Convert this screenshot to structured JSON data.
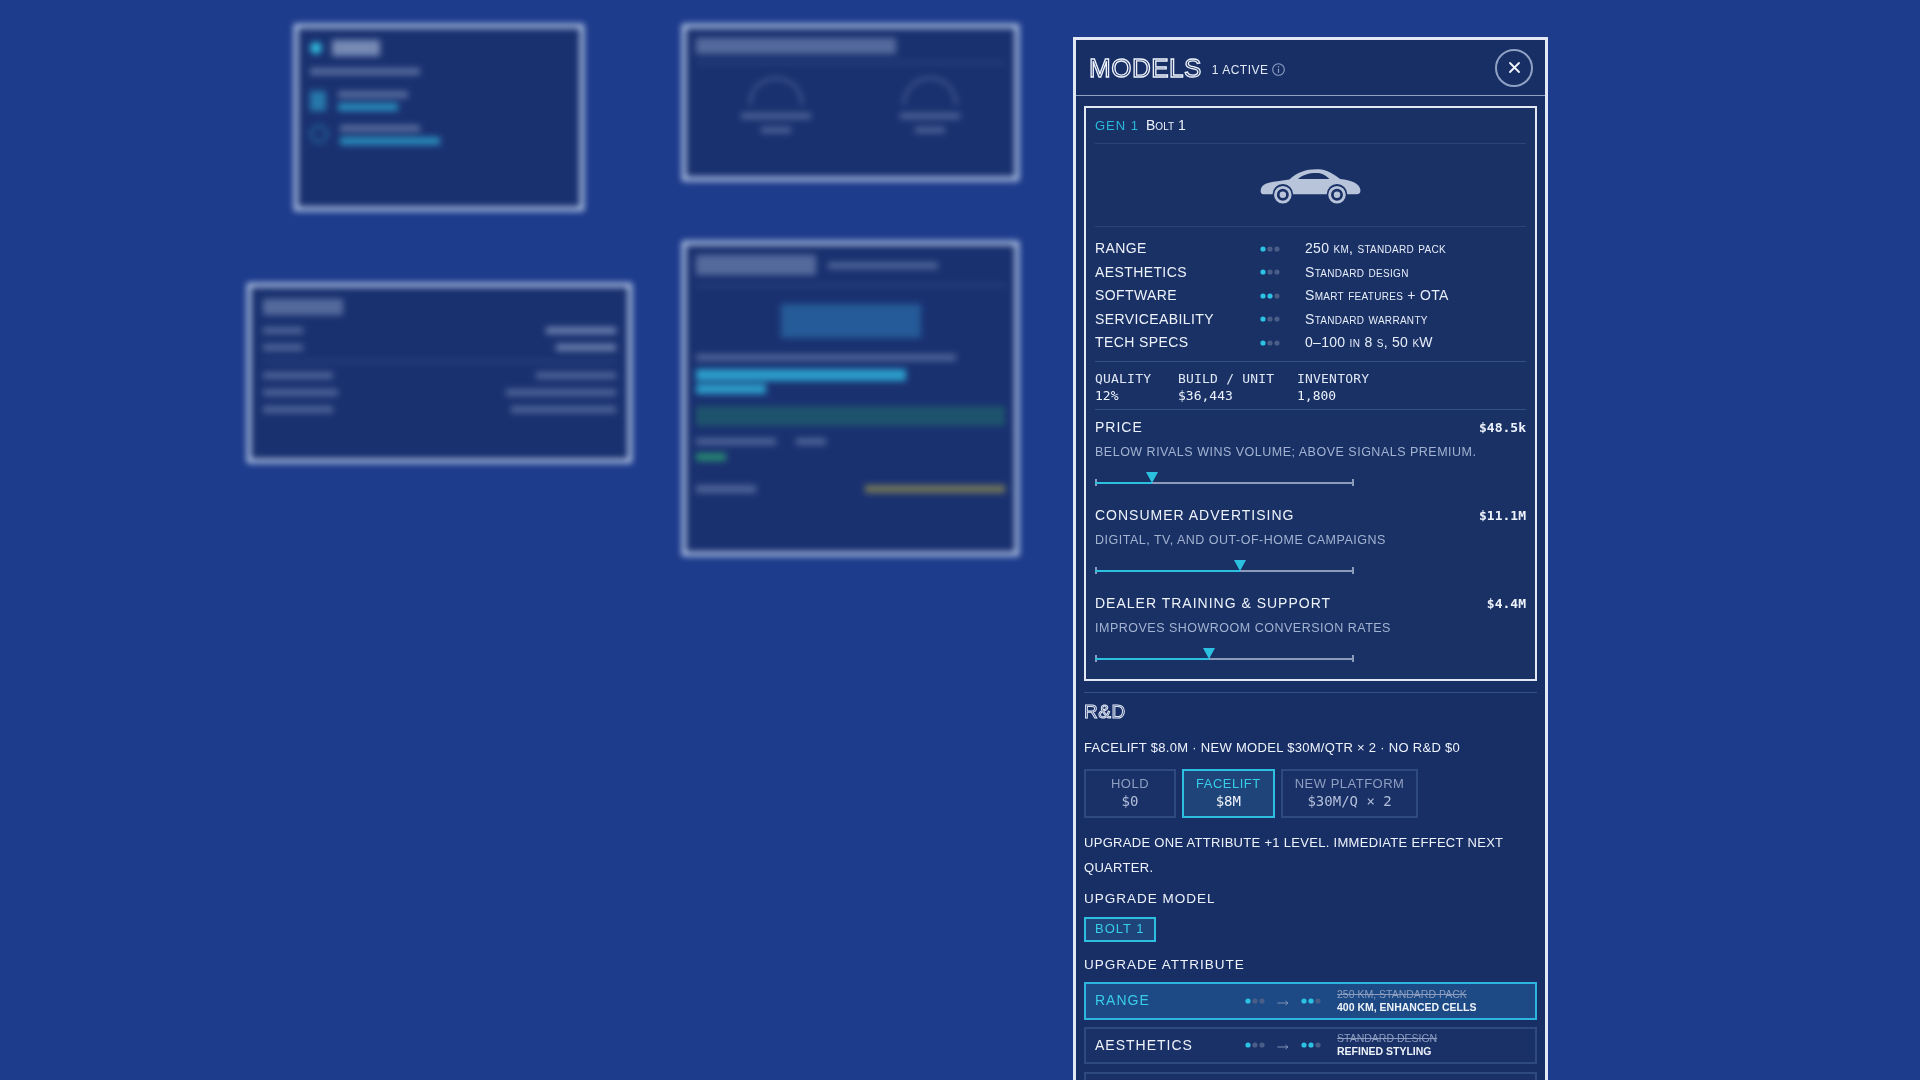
{
  "panel": {
    "title": "MODELS",
    "active_count": "1 ACTIVE"
  },
  "model": {
    "generation": "GEN 1",
    "name": "Bolt 1",
    "attributes": [
      {
        "label": "RANGE",
        "stars": 1,
        "description": "250 km, standard pack"
      },
      {
        "label": "AESTHETICS",
        "stars": 1,
        "description": "Standard design"
      },
      {
        "label": "SOFTWARE",
        "stars": 2,
        "description": "Smart features + OTA"
      },
      {
        "label": "SERVICEABILITY",
        "stars": 1,
        "description": "Standard warranty"
      },
      {
        "label": "TECH SPECS",
        "stars": 1,
        "description": "0–100 in 8 s, 50 kW"
      }
    ],
    "stats": [
      {
        "label": "QUALITY",
        "value": "12%"
      },
      {
        "label": "BUILD / UNIT",
        "value": "$36,443"
      },
      {
        "label": "INVENTORY",
        "value": "1,800"
      }
    ],
    "budgets": [
      {
        "label": "PRICE",
        "value": "$48.5k",
        "description": "BELOW RIVALS WINS VOLUME; ABOVE SIGNALS PREMIUM.",
        "level": 0.22
      },
      {
        "label": "CONSUMER ADVERTISING",
        "value": "$11.1M",
        "description": "DIGITAL, TV, AND OUT-OF-HOME CAMPAIGNS",
        "level": 0.56
      },
      {
        "label": "DEALER TRAINING & SUPPORT",
        "value": "$4.4M",
        "description": "IMPROVES SHOWROOM CONVERSION RATES",
        "level": 0.44
      }
    ]
  },
  "rnd": {
    "title": "R&D",
    "summary": "FACELIFT $8.0M · NEW MODEL $30M/QTR × 2 · NO R&D $0",
    "options": [
      {
        "label": "HOLD",
        "cost": "$0",
        "selected": false
      },
      {
        "label": "FACELIFT",
        "cost": "$8M",
        "selected": true
      },
      {
        "label": "NEW PLATFORM",
        "cost": "$30M/Q × 2",
        "selected": false
      }
    ],
    "note": "UPGRADE ONE ATTRIBUTE +1 LEVEL. IMMEDIATE EFFECT NEXT QUARTER.",
    "model_heading": "UPGRADE MODEL",
    "models": [
      {
        "label": "BOLT 1",
        "selected": true
      }
    ],
    "attribute_heading": "UPGRADE ATTRIBUTE",
    "attributes": [
      {
        "label": "RANGE",
        "selected": true,
        "current": {
          "stars": 1,
          "description": "250 KM, STANDARD PACK"
        },
        "upgraded": {
          "stars": 2,
          "description": "400 KM, ENHANCED CELLS"
        }
      },
      {
        "label": "AESTHETICS",
        "selected": false,
        "current": {
          "stars": 1,
          "description": "STANDARD DESIGN"
        },
        "upgraded": {
          "stars": 2,
          "description": "REFINED STYLING"
        }
      }
    ]
  }
}
